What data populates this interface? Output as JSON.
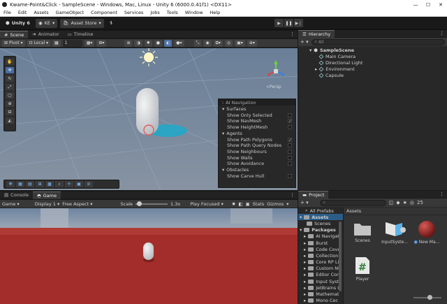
{
  "window": {
    "title": "Kwame-Point&Click - SampleScene - Windows, Mac, Linux - Unity 6 (6000.0.41f1) <DX11>",
    "min": "—",
    "max": "☐",
    "close": "✕"
  },
  "menu": [
    "File",
    "Edit",
    "Assets",
    "GameObject",
    "Component",
    "Services",
    "Jobs",
    "Tools",
    "Window",
    "Help"
  ],
  "toolbar": {
    "unity_label": "Unity 6",
    "account": "KE",
    "store": "Asset Store"
  },
  "scene_tabs": [
    "Scene",
    "Animator",
    "Timeline"
  ],
  "scene_tools": {
    "pivot": "Pivot",
    "local": "Local",
    "snap_value": "1"
  },
  "scene": {
    "persp_label": "<Persp"
  },
  "ai_nav": {
    "title": "AI Navigation",
    "surfaces": {
      "label": "Surfaces",
      "options": [
        {
          "label": "Show Only Selected",
          "checked": false
        },
        {
          "label": "Show NavMesh",
          "checked": true
        },
        {
          "label": "Show HeightMesh",
          "checked": false
        }
      ]
    },
    "agents": {
      "label": "Agents",
      "options": [
        {
          "label": "Show Path Polygons",
          "checked": true
        },
        {
          "label": "Show Path Query Nodes",
          "checked": false
        },
        {
          "label": "Show Neighbours",
          "checked": false
        },
        {
          "label": "Show Walls",
          "checked": false
        },
        {
          "label": "Show Avoidance",
          "checked": false
        }
      ]
    },
    "obstacles": {
      "label": "Obstacles",
      "options": [
        {
          "label": "Show Carve Hull",
          "checked": false
        }
      ]
    }
  },
  "bottom_tabs": [
    "Console",
    "Game"
  ],
  "game_bar": {
    "mode": "Game",
    "display": "Display 1",
    "aspect": "Free Aspect",
    "scale_label": "Scale",
    "scale_value": "1.3x",
    "play_mode": "Play Focused",
    "stats": "Stats",
    "gizmos": "Gizmos"
  },
  "hierarchy": {
    "title": "Hierarchy",
    "search": "All",
    "scene": "SampleScene",
    "items": [
      "Main Camera",
      "Directional Light",
      "Environment",
      "Capsule"
    ]
  },
  "project": {
    "title": "Project",
    "count": "25",
    "search": "All Prefabs",
    "breadcrumb": "Assets",
    "assets_root": "Assets",
    "assets_children": [
      "Scenes"
    ],
    "packages_root": "Packages",
    "packages": [
      "AI Navigati",
      "Burst",
      "Code Cove",
      "Collection",
      "Core RP Li",
      "Custom NU",
      "Editor Cor",
      "Input Syst",
      "JetBrains I",
      "Mathemat",
      "Mono Cec"
    ],
    "grid": [
      {
        "label": "Scenes",
        "kind": "folder"
      },
      {
        "label": "InputSyste...",
        "kind": "input"
      },
      {
        "label": "New Ma...",
        "kind": "material"
      },
      {
        "label": "Player",
        "kind": "script"
      }
    ]
  }
}
